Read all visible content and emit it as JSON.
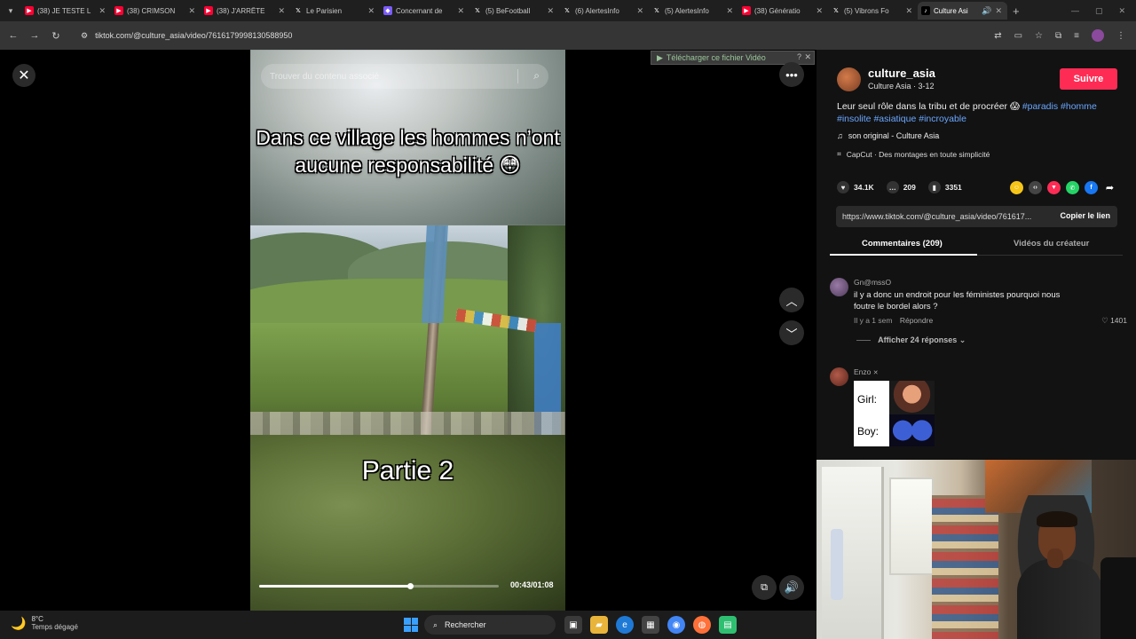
{
  "browser": {
    "tabs": [
      {
        "label": "(38) JE TESTE L",
        "icon": "youtube-icon"
      },
      {
        "label": "(38) CRIMSON",
        "icon": "youtube-icon"
      },
      {
        "label": "(38) J'ARRÊTE",
        "icon": "youtube-icon"
      },
      {
        "label": "Le Parisien",
        "icon": "x-icon"
      },
      {
        "label": "Concernant de",
        "icon": "page-icon"
      },
      {
        "label": "(5) BeFootball",
        "icon": "x-icon"
      },
      {
        "label": "(6) AlertesInfo",
        "icon": "x-icon"
      },
      {
        "label": "(5) AlertesInfo",
        "icon": "x-icon"
      },
      {
        "label": "(38) Génératio",
        "icon": "youtube-icon"
      },
      {
        "label": "(5) Vibrons Fo",
        "icon": "x-icon"
      },
      {
        "label": "Culture Asi",
        "icon": "tiktok-icon",
        "active": true
      }
    ],
    "url": "tiktok.com/@culture_asia/video/7616179998130588950"
  },
  "video": {
    "search_placeholder": "Trouver du contenu associé",
    "caption": "Dans ce village les hommes n’ont aucune responsabilité 😳",
    "part_label": "Partie 2",
    "timecode": "00:43/01:08",
    "progress": 0.63,
    "download_banner": "Télécharger ce fichier Vidéo",
    "download_help": "?"
  },
  "panel": {
    "username": "culture_asia",
    "display_name": "Culture Asia",
    "date": "3-12",
    "follow_label": "Suivre",
    "description_text": "Leur seul rôle dans la tribu et de procréer 😱",
    "hashtags": [
      "#paradis",
      "#homme",
      "#insolite",
      "#asiatique",
      "#incroyable"
    ],
    "music": "son original - Culture Asia",
    "capcut": "CapCut · Des montages en toute simplicité",
    "likes": "34.1K",
    "comments_count": "209",
    "saves": "3351",
    "link": "https://www.tiktok.com/@culture_asia/video/761617...",
    "copy_label": "Copier le lien",
    "tab_comments": "Commentaires (209)",
    "tab_creator": "Vidéos du créateur",
    "comments": [
      {
        "user": "Gn@mssO",
        "text": "il y a donc un endroit pour les féministes pourquoi nous foutre le bordel alors ?",
        "time": "Il y a 1 sem",
        "reply_label": "Répondre",
        "likes": "1401",
        "more": "Afficher 24 réponses"
      },
      {
        "user": "Enzo",
        "meme_line1": "Girl:",
        "meme_line2": "Boy:"
      }
    ]
  },
  "taskbar": {
    "temp": "8°C",
    "weather": "Temps dégagé",
    "search_label": "Rechercher"
  },
  "colors": {
    "follow": "#fe2c55",
    "hashtag": "#6aa7ff",
    "chrome_bg": "#353535"
  }
}
